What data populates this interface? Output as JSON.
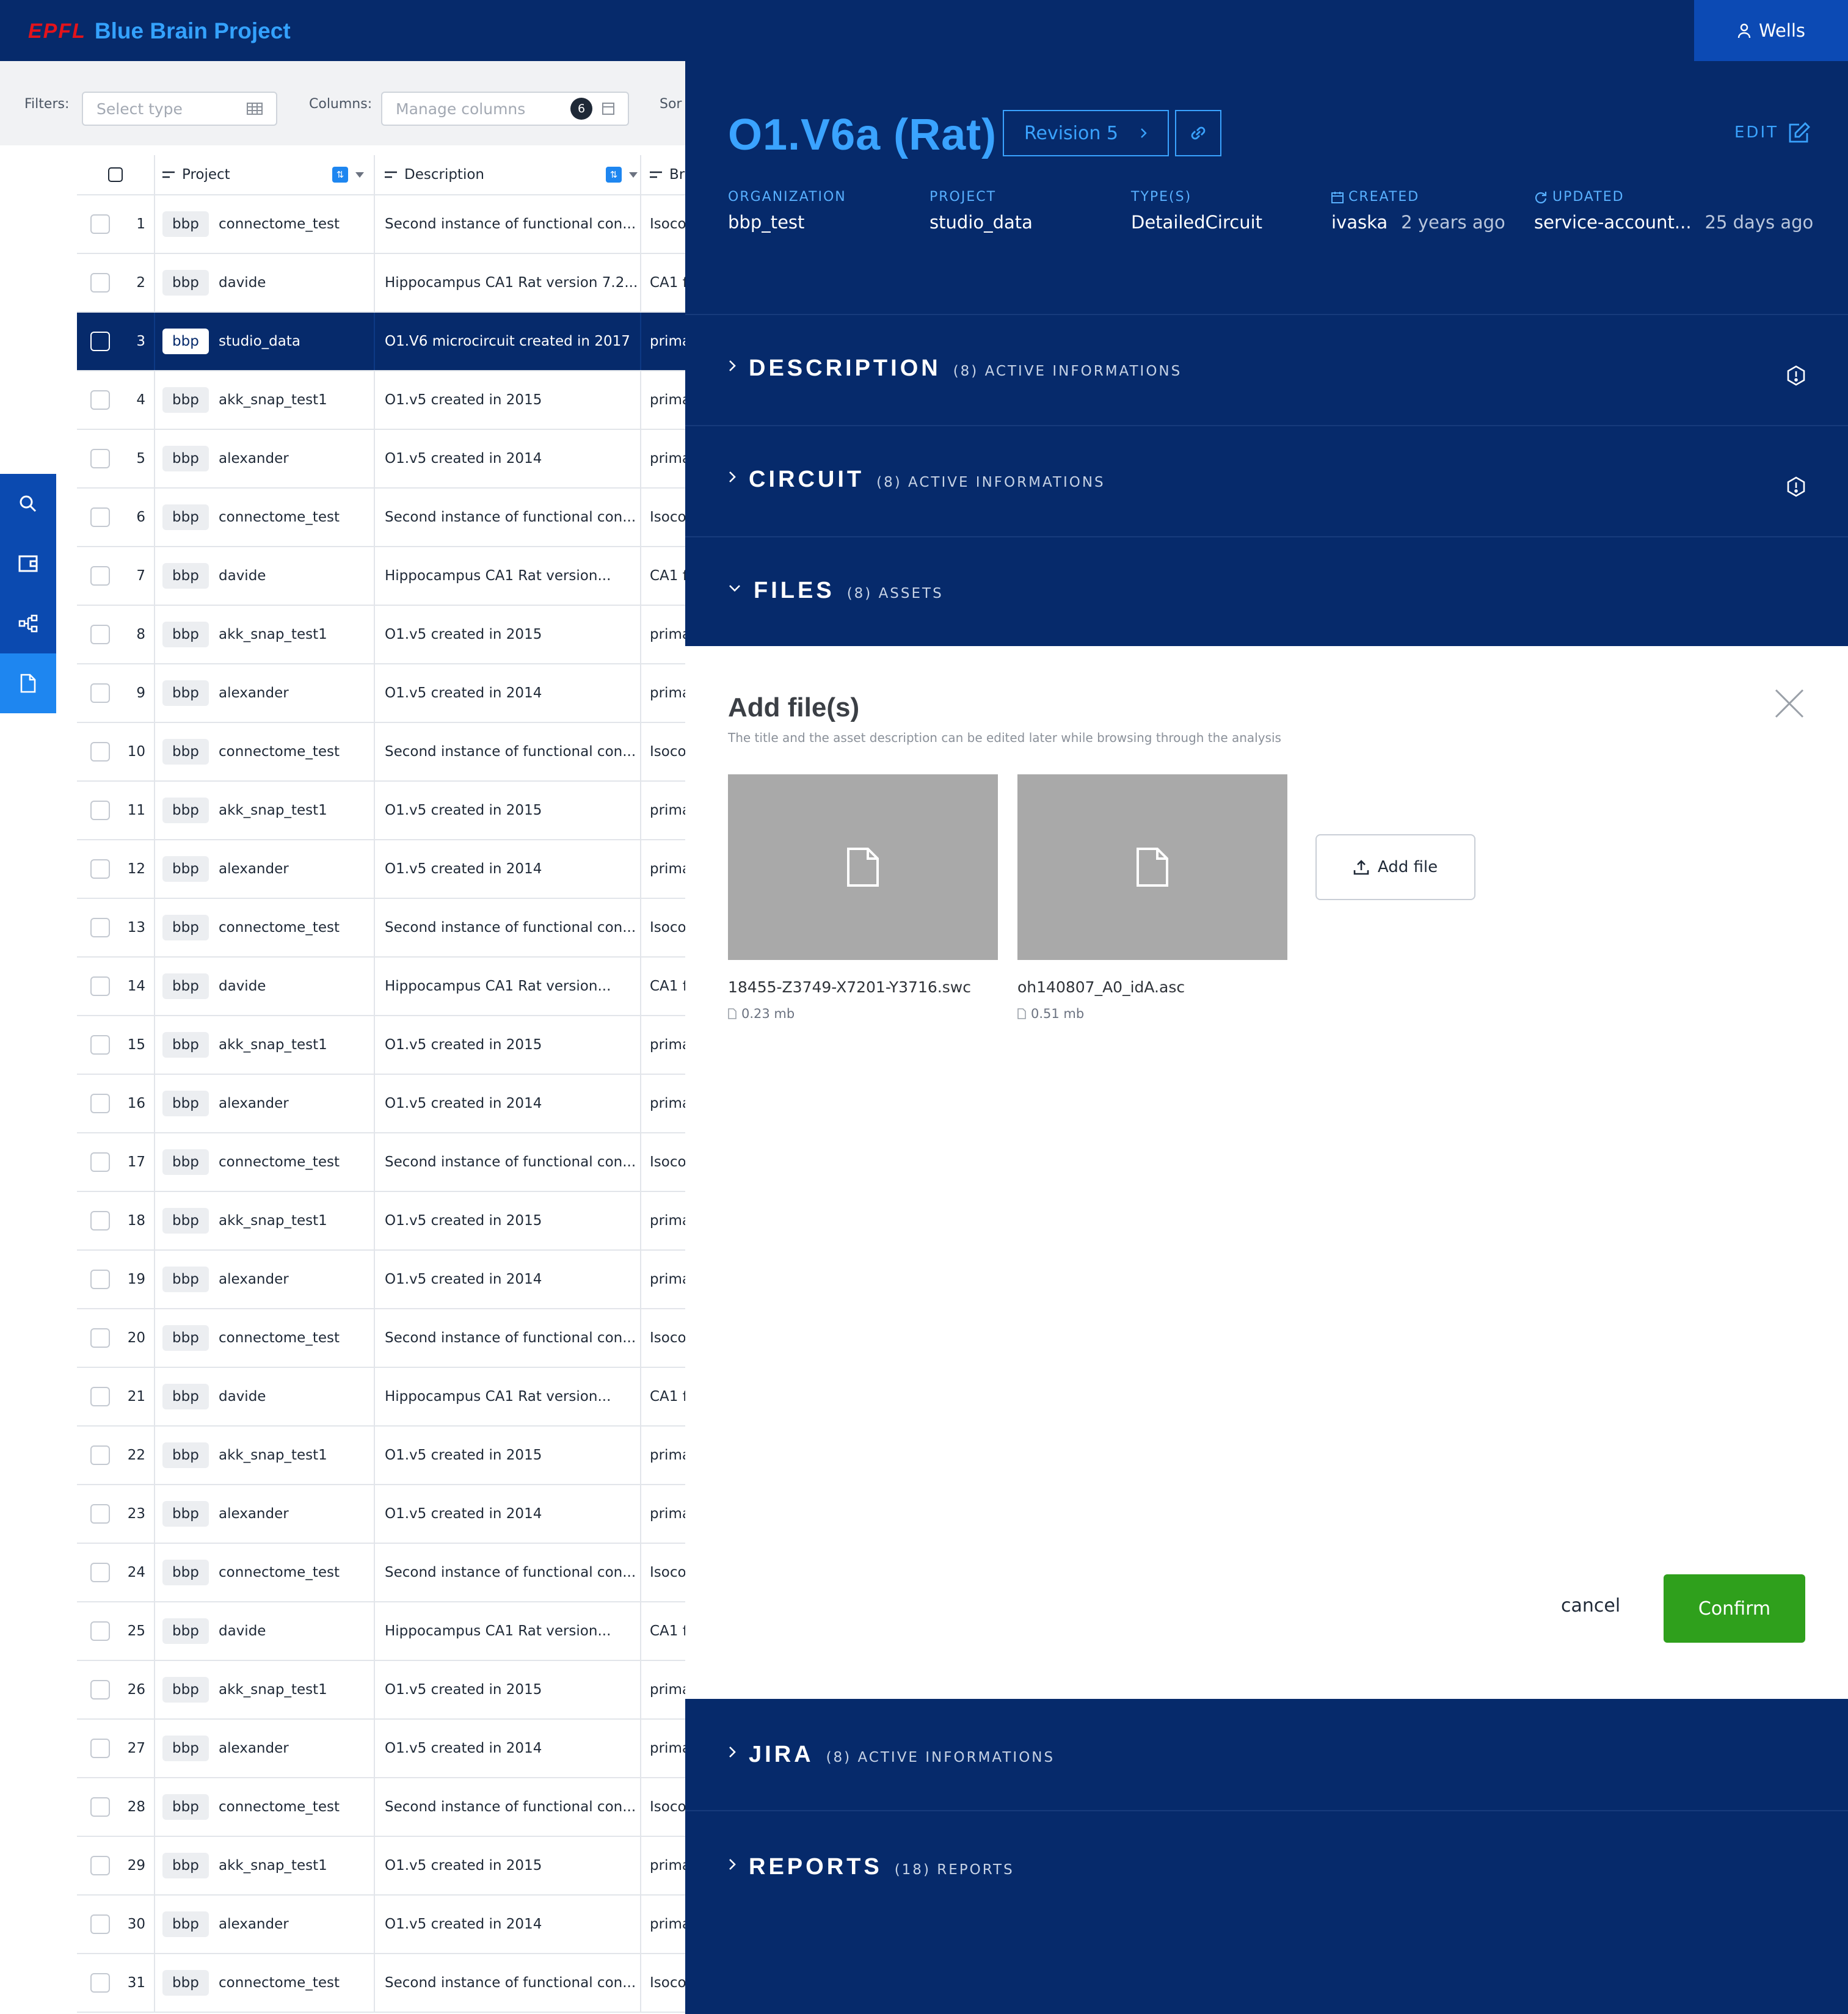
{
  "header": {
    "brand_epfl": "EPFL",
    "brand_name": "Blue Brain Project",
    "user_name": "Wells"
  },
  "filters": {
    "filters_label": "Filters:",
    "type_placeholder": "Select type",
    "columns_label": "Columns:",
    "columns_placeholder": "Manage columns",
    "columns_count": "6",
    "sort_label": "Sor"
  },
  "sidebar": {
    "icons": [
      "search-icon",
      "wallet-icon",
      "graph-icon",
      "document-icon"
    ]
  },
  "table": {
    "headers": {
      "project": "Project",
      "description": "Description",
      "third": "Br"
    },
    "rows": [
      {
        "n": "1",
        "org": "bbp",
        "project": "connectome_test",
        "description": "Second instance of functional con...",
        "extra": "Isoco"
      },
      {
        "n": "2",
        "org": "bbp",
        "project": "davide",
        "description": "Hippocampus CA1 Rat version 7.2...",
        "extra": "CA1 f"
      },
      {
        "n": "3",
        "org": "bbp",
        "project": "studio_data",
        "description": "O1.V6 microcircuit created in 2017",
        "extra": "prima",
        "selected": true
      },
      {
        "n": "4",
        "org": "bbp",
        "project": "akk_snap_test1",
        "description": "O1.v5 created in 2015",
        "extra": "prima"
      },
      {
        "n": "5",
        "org": "bbp",
        "project": "alexander",
        "description": "O1.v5 created in 2014",
        "extra": "prima"
      },
      {
        "n": "6",
        "org": "bbp",
        "project": "connectome_test",
        "description": "Second instance of functional con...",
        "extra": "Isoco"
      },
      {
        "n": "7",
        "org": "bbp",
        "project": "davide",
        "description": "Hippocampus CA1 Rat version...",
        "extra": "CA1 f"
      },
      {
        "n": "8",
        "org": "bbp",
        "project": "akk_snap_test1",
        "description": "O1.v5 created in 2015",
        "extra": "prima"
      },
      {
        "n": "9",
        "org": "bbp",
        "project": "alexander",
        "description": "O1.v5 created in 2014",
        "extra": "prima"
      },
      {
        "n": "10",
        "org": "bbp",
        "project": "connectome_test",
        "description": "Second instance of functional con...",
        "extra": "Isoco"
      },
      {
        "n": "11",
        "org": "bbp",
        "project": "akk_snap_test1",
        "description": "O1.v5 created in 2015",
        "extra": "prima"
      },
      {
        "n": "12",
        "org": "bbp",
        "project": "alexander",
        "description": "O1.v5 created in 2014",
        "extra": "prima"
      },
      {
        "n": "13",
        "org": "bbp",
        "project": "connectome_test",
        "description": "Second instance of functional con...",
        "extra": "Isoco"
      },
      {
        "n": "14",
        "org": "bbp",
        "project": "davide",
        "description": "Hippocampus CA1 Rat version...",
        "extra": "CA1 f"
      },
      {
        "n": "15",
        "org": "bbp",
        "project": "akk_snap_test1",
        "description": "O1.v5 created in 2015",
        "extra": "prima"
      },
      {
        "n": "16",
        "org": "bbp",
        "project": "alexander",
        "description": "O1.v5 created in 2014",
        "extra": "prima"
      },
      {
        "n": "17",
        "org": "bbp",
        "project": "connectome_test",
        "description": "Second instance of functional con...",
        "extra": "Isoco"
      },
      {
        "n": "18",
        "org": "bbp",
        "project": "akk_snap_test1",
        "description": "O1.v5 created in 2015",
        "extra": "prima"
      },
      {
        "n": "19",
        "org": "bbp",
        "project": "alexander",
        "description": "O1.v5 created in 2014",
        "extra": "prima"
      },
      {
        "n": "20",
        "org": "bbp",
        "project": "connectome_test",
        "description": "Second instance of functional con...",
        "extra": "Isoco"
      },
      {
        "n": "21",
        "org": "bbp",
        "project": "davide",
        "description": "Hippocampus CA1 Rat version...",
        "extra": "CA1 f"
      },
      {
        "n": "22",
        "org": "bbp",
        "project": "akk_snap_test1",
        "description": "O1.v5 created in 2015",
        "extra": "prima"
      },
      {
        "n": "23",
        "org": "bbp",
        "project": "alexander",
        "description": "O1.v5 created in 2014",
        "extra": "prima"
      },
      {
        "n": "24",
        "org": "bbp",
        "project": "connectome_test",
        "description": "Second instance of functional con...",
        "extra": "Isoco"
      },
      {
        "n": "25",
        "org": "bbp",
        "project": "davide",
        "description": "Hippocampus CA1 Rat version...",
        "extra": "CA1 f"
      },
      {
        "n": "26",
        "org": "bbp",
        "project": "akk_snap_test1",
        "description": "O1.v5 created in 2015",
        "extra": "prima"
      },
      {
        "n": "27",
        "org": "bbp",
        "project": "alexander",
        "description": "O1.v5 created in 2014",
        "extra": "prima"
      },
      {
        "n": "28",
        "org": "bbp",
        "project": "connectome_test",
        "description": "Second instance of functional con...",
        "extra": "Isoco"
      },
      {
        "n": "29",
        "org": "bbp",
        "project": "akk_snap_test1",
        "description": "O1.v5 created in 2015",
        "extra": "prima"
      },
      {
        "n": "30",
        "org": "bbp",
        "project": "alexander",
        "description": "O1.v5 created in 2014",
        "extra": "prima"
      },
      {
        "n": "31",
        "org": "bbp",
        "project": "connectome_test",
        "description": "Second instance of functional con...",
        "extra": "Isoco"
      }
    ]
  },
  "detail": {
    "title": "O1.V6a (Rat)",
    "revision_label": "Revision 5",
    "edit_label": "EDIT",
    "meta": {
      "organization_label": "ORGANIZATION",
      "organization_value": "bbp_test",
      "project_label": "PROJECT",
      "project_value": "studio_data",
      "types_label": "TYPE(S)",
      "types_value": "DetailedCircuit",
      "created_label": "CREATED",
      "created_by": "ivaska",
      "created_when": "2 years ago",
      "updated_label": "UPDATED",
      "updated_by": "service-account...",
      "updated_when": "25 days ago"
    },
    "sections": {
      "description": {
        "name": "DESCRIPTION",
        "count": "(8) ACTIVE INFORMATIONS"
      },
      "circuit": {
        "name": "CIRCUIT",
        "count": "(8) ACTIVE INFORMATIONS"
      },
      "files": {
        "name": "FILES",
        "count": "(8) ASSETS"
      },
      "jira": {
        "name": "JIRA",
        "count": "(8) ACTIVE INFORMATIONS"
      },
      "reports": {
        "name": "REPORTS",
        "count": "(18) REPORTS"
      }
    },
    "add_files": {
      "title": "Add file(s)",
      "subtitle": "The title and the asset description can be edited later while browsing through the analysis",
      "files": [
        {
          "name": "18455-Z3749-X7201-Y3716.swc",
          "size": "0.23 mb"
        },
        {
          "name": "oh140807_A0_idA.asc",
          "size": "0.51 mb"
        }
      ],
      "add_file_label": "Add file",
      "cancel_label": "cancel",
      "confirm_label": "Confirm"
    }
  },
  "colors": {
    "navy": "#062a6b",
    "accent_blue": "#3aa3ff",
    "confirm_green": "#2fa01c",
    "epfl_red": "#e3131b"
  }
}
